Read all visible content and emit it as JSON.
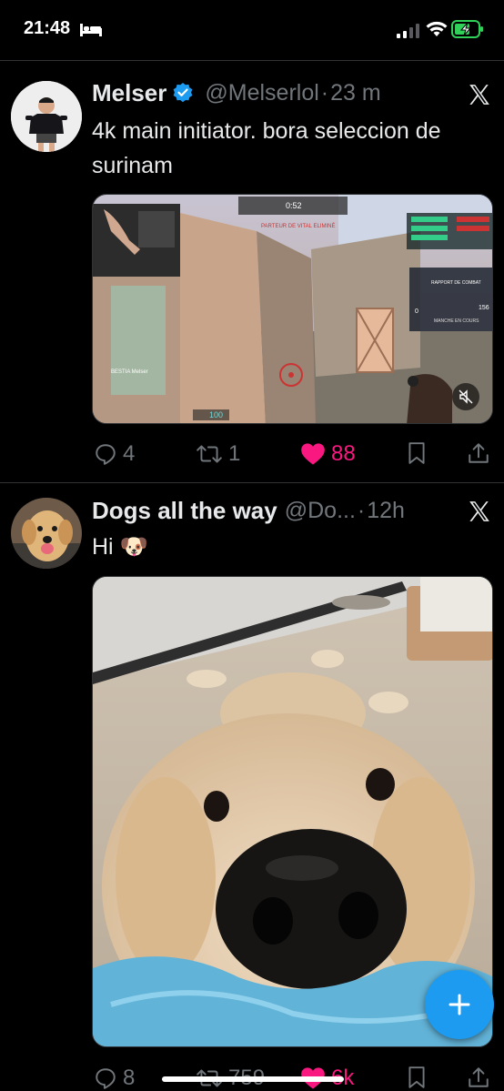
{
  "status_bar": {
    "time": "21:48",
    "battery_color": "#30d158"
  },
  "tweets": [
    {
      "display_name": "Melser",
      "verified": true,
      "handle": "@Melserlol",
      "sep": "·",
      "time": "23 m",
      "text": "4k main initiator.  bora seleccion de surinam",
      "media": {
        "kind": "video",
        "hud": {
          "timer": "0:52",
          "health": "100",
          "overlay_name": "BESTIA Melser",
          "stats_a": "0",
          "stats_b": "156",
          "panel_title": "RAPPORT DE COMBAT",
          "panel_sub": "MANCHE EN COURS",
          "banner": "PARTEUR DE VITAL ELIMINÉ"
        }
      },
      "actions": {
        "replies": "4",
        "reposts": "1",
        "likes": "88",
        "liked": true
      }
    },
    {
      "display_name": "Dogs all the way",
      "verified": false,
      "handle": "@Do...",
      "sep": "·",
      "time": "12h",
      "text": "Hi 🐶",
      "media": {
        "kind": "photo",
        "subject": "golden retriever puppy close-up"
      },
      "actions": {
        "replies": "8",
        "reposts": "759",
        "likes": "6k",
        "liked": true
      }
    }
  ],
  "colors": {
    "accent": "#1d9bf0",
    "like": "#f91880",
    "muted": "#71767b",
    "divider": "#2f3336"
  }
}
